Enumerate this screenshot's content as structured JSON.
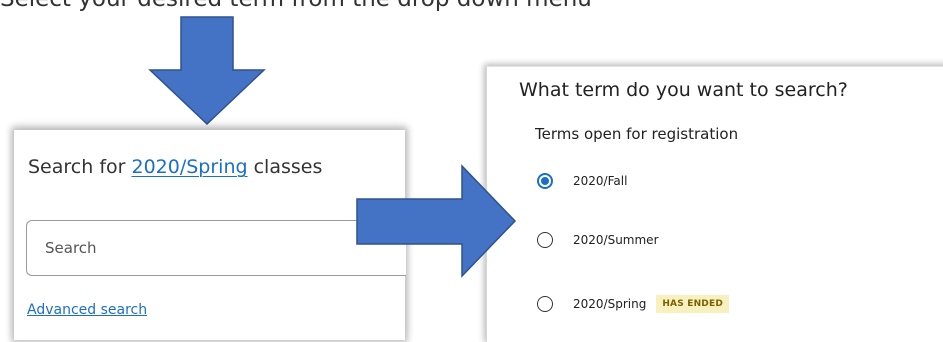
{
  "instruction": {
    "text": "Select your desired term from the drop down menu"
  },
  "search_panel": {
    "title_prefix": "Search for ",
    "term_link": "2020/Spring",
    "title_suffix": " classes",
    "search_placeholder": "Search",
    "advanced_search_link": "Advanced search"
  },
  "term_panel": {
    "question": "What term do you want to search?",
    "open_heading": "Terms open for registration",
    "options": [
      {
        "label": "2020/Fall",
        "selected": true,
        "badge": ""
      },
      {
        "label": "2020/Summer",
        "selected": false,
        "badge": ""
      },
      {
        "label": "2020/Spring",
        "selected": false,
        "badge": "HAS ENDED"
      }
    ]
  },
  "colors": {
    "arrow_fill": "#4472c4",
    "arrow_stroke": "#2f528f",
    "link": "#1a6fc9",
    "radio_selected": "#1a6fc9",
    "badge_bg": "#f8f0bf",
    "badge_text": "#7a6100"
  },
  "icons": {
    "down_arrow": "down-arrow-icon",
    "right_arrow": "right-arrow-icon"
  }
}
